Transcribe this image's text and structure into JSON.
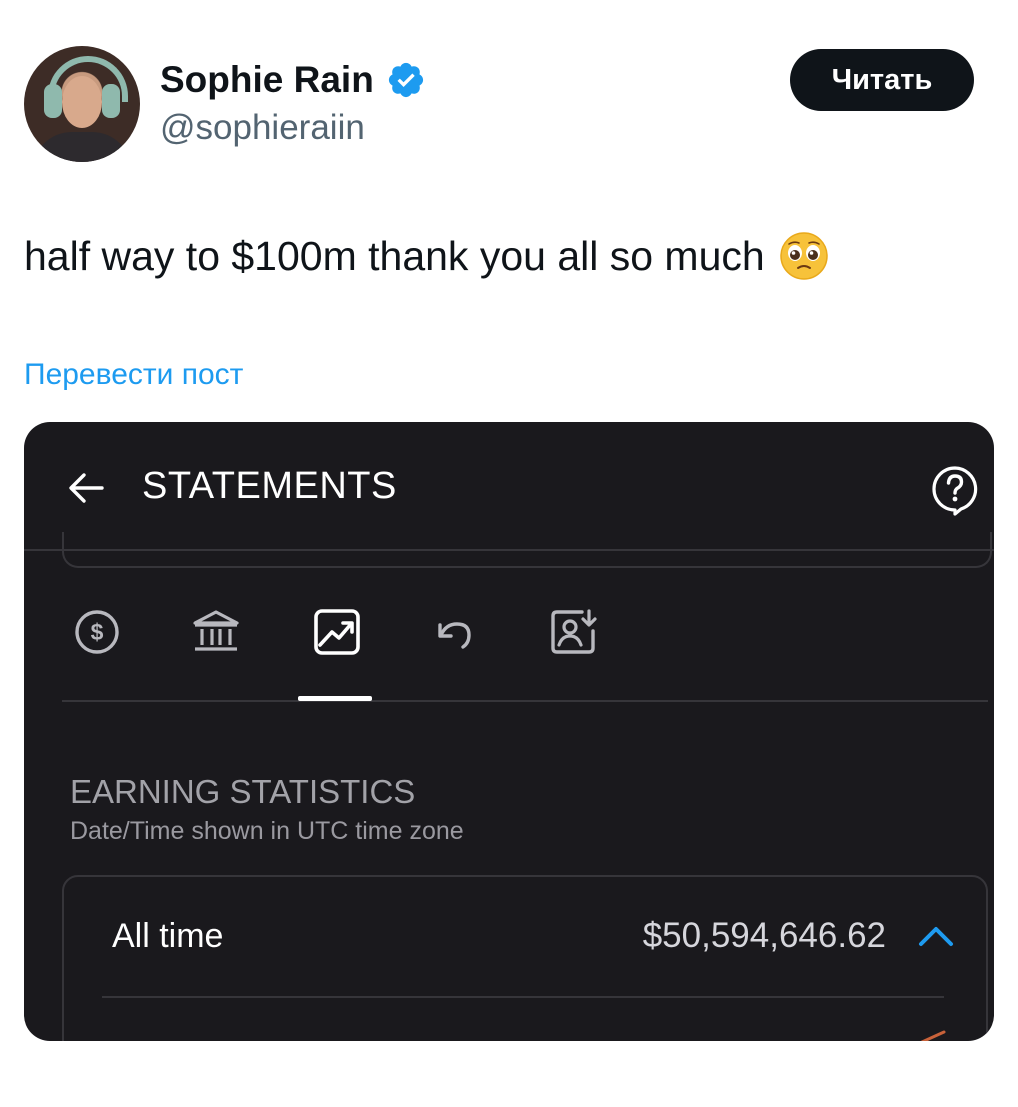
{
  "tweet": {
    "author_name": "Sophie Rain",
    "handle": "@sophieraiin",
    "follow_label": "Читать",
    "text": "half way to $100m thank you all so much",
    "emoji": "pleading-face-emoji",
    "translate_label": "Перевести пост"
  },
  "statements": {
    "title": "STATEMENTS",
    "tabs": [
      {
        "icon": "dollar-circle-icon",
        "active": false
      },
      {
        "icon": "bank-icon",
        "active": false
      },
      {
        "icon": "chart-trend-icon",
        "active": true
      },
      {
        "icon": "refund-icon",
        "active": false
      },
      {
        "icon": "user-card-download-icon",
        "active": false
      }
    ],
    "section_title": "EARNING STATISTICS",
    "section_subtitle": "Date/Time shown in UTC time zone",
    "period_label": "All time",
    "period_amount": "$50,594,646.62"
  },
  "colors": {
    "accent": "#1d9bf0",
    "card_bg": "#1a191d",
    "chevron": "#1e9bf0"
  }
}
